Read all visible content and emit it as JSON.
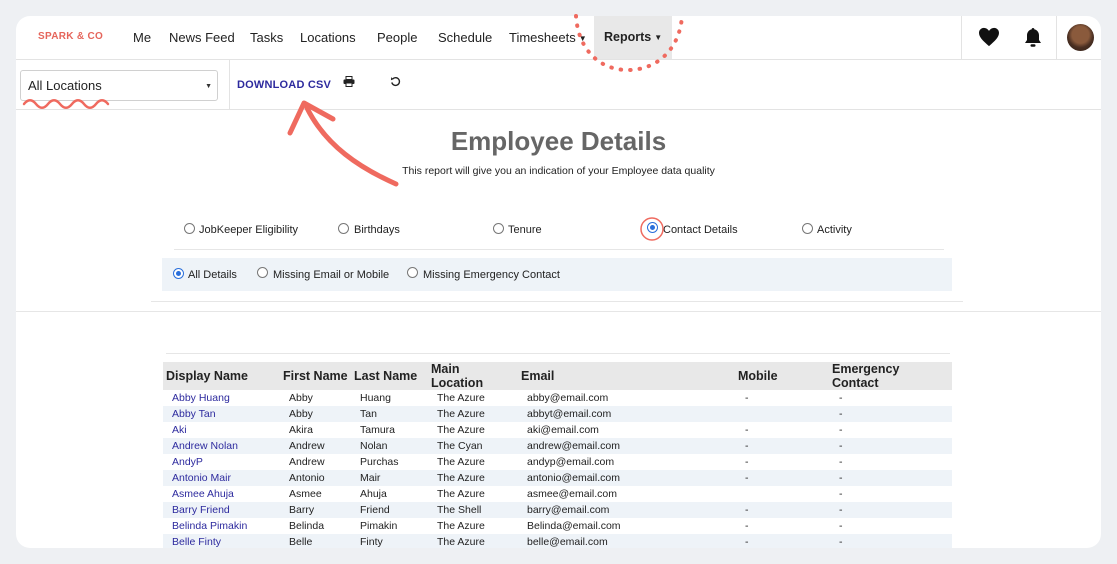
{
  "nav": {
    "logo": "SPARK & CO",
    "items": [
      "Me",
      "News Feed",
      "Tasks",
      "Locations",
      "People",
      "Schedule",
      "Timesheets",
      "Reports"
    ],
    "active": "Reports"
  },
  "toolbar": {
    "location_value": "All Locations",
    "download_label": "DOWNLOAD CSV"
  },
  "report": {
    "title": "Employee Details",
    "subtitle": "This report will give you an indication of your Employee data quality",
    "types": [
      "JobKeeper Eligibility",
      "Birthdays",
      "Tenure",
      "Contact Details",
      "Activity"
    ],
    "selected_type": "Contact Details",
    "filters": [
      "All Details",
      "Missing Email or Mobile",
      "Missing Emergency Contact"
    ],
    "selected_filter": "All Details"
  },
  "table": {
    "columns": [
      "Display Name",
      "First Name",
      "Last Name",
      "Main Location",
      "Email",
      "Mobile",
      "Emergency Contact"
    ],
    "rows": [
      [
        "Abby Huang",
        "Abby",
        "Huang",
        "The Azure",
        "abby@email.com",
        "-",
        "-"
      ],
      [
        "Abby Tan",
        "Abby",
        "Tan",
        "The Azure",
        "abbyt@email.com",
        "",
        "-"
      ],
      [
        "Aki",
        "Akira",
        "Tamura",
        "The Azure",
        "aki@email.com",
        "-",
        "-"
      ],
      [
        "Andrew Nolan",
        "Andrew",
        "Nolan",
        "The Cyan",
        "andrew@email.com",
        "-",
        "-"
      ],
      [
        "AndyP",
        "Andrew",
        "Purchas",
        "The Azure",
        "andyp@email.com",
        "-",
        "-"
      ],
      [
        "Antonio Mair",
        "Antonio",
        "Mair",
        "The Azure",
        "antonio@email.com",
        "-",
        "-"
      ],
      [
        "Asmee Ahuja",
        "Asmee",
        "Ahuja",
        "The Azure",
        "asmee@email.com",
        "",
        "-"
      ],
      [
        "Barry Friend",
        "Barry",
        "Friend",
        "The Shell",
        "barry@email.com",
        "-",
        "-"
      ],
      [
        "Belinda Pimakin",
        "Belinda",
        "Pimakin",
        "The Azure",
        "Belinda@email.com",
        "-",
        "-"
      ],
      [
        "Belle Finty",
        "Belle",
        "Finty",
        "The Azure",
        "belle@email.com",
        "-",
        "-"
      ]
    ]
  },
  "icons": [
    "heart-icon",
    "bell-icon",
    "print-icon",
    "refresh-icon"
  ],
  "colors": {
    "accent": "#2d2a9e",
    "logo": "#e5655b",
    "annotation": "#ef6a5f",
    "radio": "#2a6fdb"
  }
}
